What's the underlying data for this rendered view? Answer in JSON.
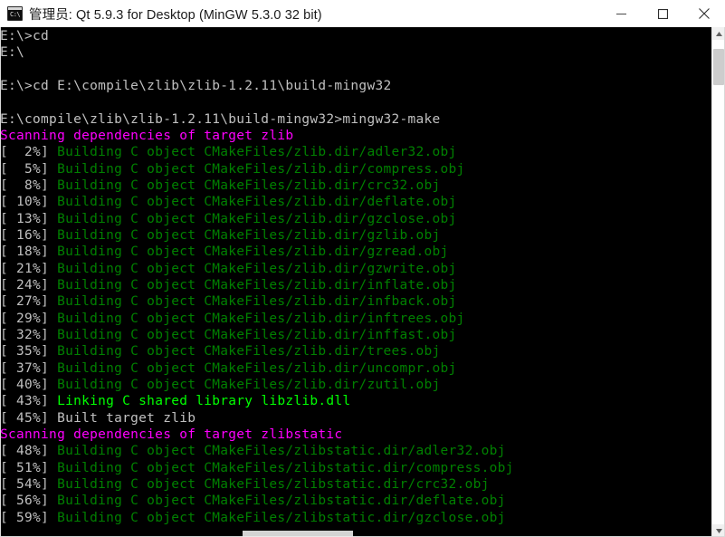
{
  "window": {
    "title": "管理员: Qt 5.9.3 for Desktop (MinGW 5.3.0 32 bit)",
    "icon_name": "cmd-console-icon",
    "icon_prompt_glyph": "C:\\",
    "controls": {
      "minimize_label": "Minimize",
      "maximize_label": "Maximize",
      "close_label": "Close"
    }
  },
  "colors": {
    "titlebar_bg": "#ffffff",
    "title_text": "#1b1b1b",
    "console_bg": "#000000",
    "text_gray": "#c0c0c0",
    "text_green": "#008000",
    "text_bright_green": "#00ff00",
    "text_magenta": "#ff00ff",
    "scrollbar_track": "#ffffff",
    "scrollbar_thumb": "#cdcdcd"
  },
  "scrollbar": {
    "up_arrow": "▲",
    "down_arrow": "▼",
    "thumb_position_pct": 2
  },
  "watermark": {
    "text": ""
  },
  "console": {
    "lines": [
      {
        "segs": [
          {
            "t": "E:\\>cd",
            "c": "gray"
          }
        ]
      },
      {
        "segs": [
          {
            "t": "E:\\",
            "c": "gray"
          }
        ]
      },
      {
        "segs": [
          {
            "t": "",
            "c": "gray"
          }
        ]
      },
      {
        "segs": [
          {
            "t": "E:\\>cd E:\\compile\\zlib\\zlib-1.2.11\\build-mingw32",
            "c": "gray"
          }
        ]
      },
      {
        "segs": [
          {
            "t": "",
            "c": "gray"
          }
        ]
      },
      {
        "segs": [
          {
            "t": "E:\\compile\\zlib\\zlib-1.2.11\\build-mingw32>mingw32-make",
            "c": "gray"
          }
        ]
      },
      {
        "segs": [
          {
            "t": "Scanning dependencies of target zlib",
            "c": "magenta"
          }
        ]
      },
      {
        "segs": [
          {
            "t": "[  2%] ",
            "c": "gray"
          },
          {
            "t": "Building C object CMakeFiles/zlib.dir/adler32.obj",
            "c": "green"
          }
        ]
      },
      {
        "segs": [
          {
            "t": "[  5%] ",
            "c": "gray"
          },
          {
            "t": "Building C object CMakeFiles/zlib.dir/compress.obj",
            "c": "green"
          }
        ]
      },
      {
        "segs": [
          {
            "t": "[  8%] ",
            "c": "gray"
          },
          {
            "t": "Building C object CMakeFiles/zlib.dir/crc32.obj",
            "c": "green"
          }
        ]
      },
      {
        "segs": [
          {
            "t": "[ 10%] ",
            "c": "gray"
          },
          {
            "t": "Building C object CMakeFiles/zlib.dir/deflate.obj",
            "c": "green"
          }
        ]
      },
      {
        "segs": [
          {
            "t": "[ 13%] ",
            "c": "gray"
          },
          {
            "t": "Building C object CMakeFiles/zlib.dir/gzclose.obj",
            "c": "green"
          }
        ]
      },
      {
        "segs": [
          {
            "t": "[ 16%] ",
            "c": "gray"
          },
          {
            "t": "Building C object CMakeFiles/zlib.dir/gzlib.obj",
            "c": "green"
          }
        ]
      },
      {
        "segs": [
          {
            "t": "[ 18%] ",
            "c": "gray"
          },
          {
            "t": "Building C object CMakeFiles/zlib.dir/gzread.obj",
            "c": "green"
          }
        ]
      },
      {
        "segs": [
          {
            "t": "[ 21%] ",
            "c": "gray"
          },
          {
            "t": "Building C object CMakeFiles/zlib.dir/gzwrite.obj",
            "c": "green"
          }
        ]
      },
      {
        "segs": [
          {
            "t": "[ 24%] ",
            "c": "gray"
          },
          {
            "t": "Building C object CMakeFiles/zlib.dir/inflate.obj",
            "c": "green"
          }
        ]
      },
      {
        "segs": [
          {
            "t": "[ 27%] ",
            "c": "gray"
          },
          {
            "t": "Building C object CMakeFiles/zlib.dir/infback.obj",
            "c": "green"
          }
        ]
      },
      {
        "segs": [
          {
            "t": "[ 29%] ",
            "c": "gray"
          },
          {
            "t": "Building C object CMakeFiles/zlib.dir/inftrees.obj",
            "c": "green"
          }
        ]
      },
      {
        "segs": [
          {
            "t": "[ 32%] ",
            "c": "gray"
          },
          {
            "t": "Building C object CMakeFiles/zlib.dir/inffast.obj",
            "c": "green"
          }
        ]
      },
      {
        "segs": [
          {
            "t": "[ 35%] ",
            "c": "gray"
          },
          {
            "t": "Building C object CMakeFiles/zlib.dir/trees.obj",
            "c": "green"
          }
        ]
      },
      {
        "segs": [
          {
            "t": "[ 37%] ",
            "c": "gray"
          },
          {
            "t": "Building C object CMakeFiles/zlib.dir/uncompr.obj",
            "c": "green"
          }
        ]
      },
      {
        "segs": [
          {
            "t": "[ 40%] ",
            "c": "gray"
          },
          {
            "t": "Building C object CMakeFiles/zlib.dir/zutil.obj",
            "c": "green"
          }
        ]
      },
      {
        "segs": [
          {
            "t": "[ 43%] ",
            "c": "gray"
          },
          {
            "t": "Linking C shared library libzlib.dll",
            "c": "bgreen"
          }
        ]
      },
      {
        "segs": [
          {
            "t": "[ 45%] Built target zlib",
            "c": "gray"
          }
        ]
      },
      {
        "segs": [
          {
            "t": "Scanning dependencies of target zlibstatic",
            "c": "magenta"
          }
        ]
      },
      {
        "segs": [
          {
            "t": "[ 48%] ",
            "c": "gray"
          },
          {
            "t": "Building C object CMakeFiles/zlibstatic.dir/adler32.obj",
            "c": "green"
          }
        ]
      },
      {
        "segs": [
          {
            "t": "[ 51%] ",
            "c": "gray"
          },
          {
            "t": "Building C object CMakeFiles/zlibstatic.dir/compress.obj",
            "c": "green"
          }
        ]
      },
      {
        "segs": [
          {
            "t": "[ 54%] ",
            "c": "gray"
          },
          {
            "t": "Building C object CMakeFiles/zlibstatic.dir/crc32.obj",
            "c": "green"
          }
        ]
      },
      {
        "segs": [
          {
            "t": "[ 56%] ",
            "c": "gray"
          },
          {
            "t": "Building C object CMakeFiles/zlibstatic.dir/deflate.obj",
            "c": "green"
          }
        ]
      },
      {
        "segs": [
          {
            "t": "[ 59%] ",
            "c": "gray"
          },
          {
            "t": "Building C object CMakeFiles/zlibstatic.dir/gzclose.obj",
            "c": "green"
          }
        ]
      }
    ]
  }
}
